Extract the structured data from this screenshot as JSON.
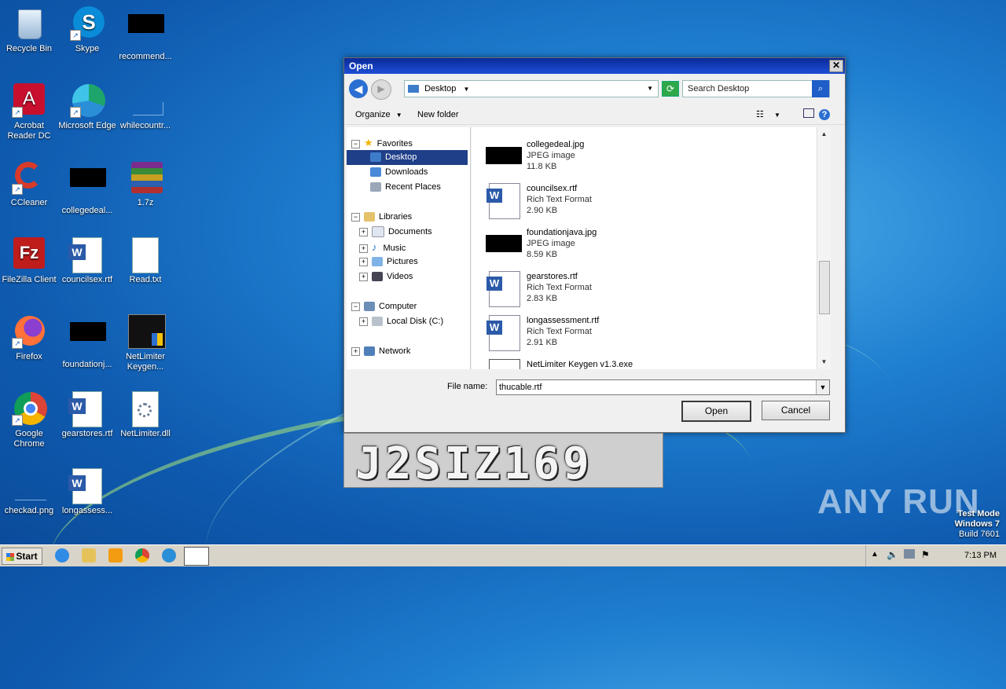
{
  "desktop": {
    "icons": [
      {
        "label": "Recycle Bin"
      },
      {
        "label": "Skype"
      },
      {
        "label": "recommend..."
      },
      {
        "label": "Acrobat Reader DC"
      },
      {
        "label": "Microsoft Edge"
      },
      {
        "label": "whilecountr..."
      },
      {
        "label": "CCleaner"
      },
      {
        "label": "collegedeal..."
      },
      {
        "label": "1.7z"
      },
      {
        "label": "FileZilla Client"
      },
      {
        "label": "councilsex.rtf"
      },
      {
        "label": "Read.txt"
      },
      {
        "label": "Firefox"
      },
      {
        "label": "foundationj..."
      },
      {
        "label": "NetLimiter Keygen..."
      },
      {
        "label": "Google Chrome"
      },
      {
        "label": "gearstores.rtf"
      },
      {
        "label": "NetLimiter.dll"
      },
      {
        "label": "checkad.png"
      },
      {
        "label": "longassess..."
      }
    ]
  },
  "dialog": {
    "title": "Open",
    "address": "Desktop",
    "search_placeholder": "Search Desktop",
    "toolbar": {
      "organize": "Organize",
      "new_folder": "New folder"
    },
    "nav": {
      "favorites": "Favorites",
      "desktop": "Desktop",
      "downloads": "Downloads",
      "recent": "Recent Places",
      "libraries": "Libraries",
      "documents": "Documents",
      "music": "Music",
      "pictures": "Pictures",
      "videos": "Videos",
      "computer": "Computer",
      "local_disk": "Local Disk (C:)",
      "network": "Network"
    },
    "files": [
      {
        "name": "collegedeal.jpg",
        "type": "JPEG image",
        "size": "11.8 KB"
      },
      {
        "name": "councilsex.rtf",
        "type": "Rich Text Format",
        "size": "2.90 KB"
      },
      {
        "name": "foundationjava.jpg",
        "type": "JPEG image",
        "size": "8.59 KB"
      },
      {
        "name": "gearstores.rtf",
        "type": "Rich Text Format",
        "size": "2.83 KB"
      },
      {
        "name": "longassessment.rtf",
        "type": "Rich Text Format",
        "size": "2.91 KB"
      },
      {
        "name": "NetLimiter Keygen v1.3.exe"
      }
    ],
    "file_name_label": "File name:",
    "file_name_value": "thucable.rtf",
    "open_label": "Open",
    "cancel_label": "Cancel"
  },
  "banner": {
    "text": "J2SIZ169"
  },
  "taskbar": {
    "start_label": "Start",
    "clock": "7:13 PM"
  },
  "watermark": {
    "line1": "Test Mode",
    "line2": "Windows 7",
    "line3": "Build 7601",
    "brand": "ANY RUN"
  }
}
